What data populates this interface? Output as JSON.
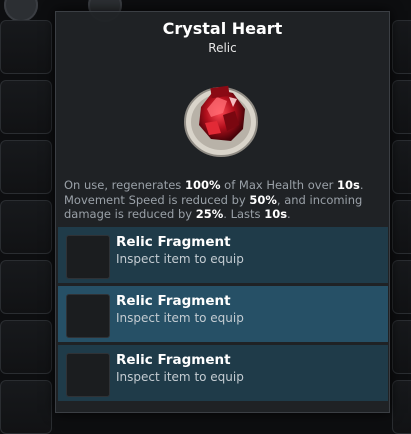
{
  "tooltip": {
    "title": "Crystal Heart",
    "subtitle": "Relic",
    "item_icon": "crystal-heart-relic-icon",
    "description": {
      "p1": "On use, regenerates ",
      "v1": "100%",
      "p2": " of Max Health over ",
      "v2": "10s",
      "p3": ". Movement Speed is reduced by ",
      "v3": "50%",
      "p4": ", and incoming damage is reduced by ",
      "v4": "25%",
      "p5": ". Lasts ",
      "v5": "10s",
      "p6": "."
    },
    "slots": [
      {
        "name": "Relic Fragment",
        "hint": "Inspect item to equip"
      },
      {
        "name": "Relic Fragment",
        "hint": "Inspect item to equip"
      },
      {
        "name": "Relic Fragment",
        "hint": "Inspect item to equip"
      }
    ]
  },
  "colors": {
    "panel": "#202326",
    "slot_odd": "#1f3b49",
    "slot_even": "#265066",
    "desc_text": "#9aa1a8",
    "crystal_red": "#c0121e"
  }
}
